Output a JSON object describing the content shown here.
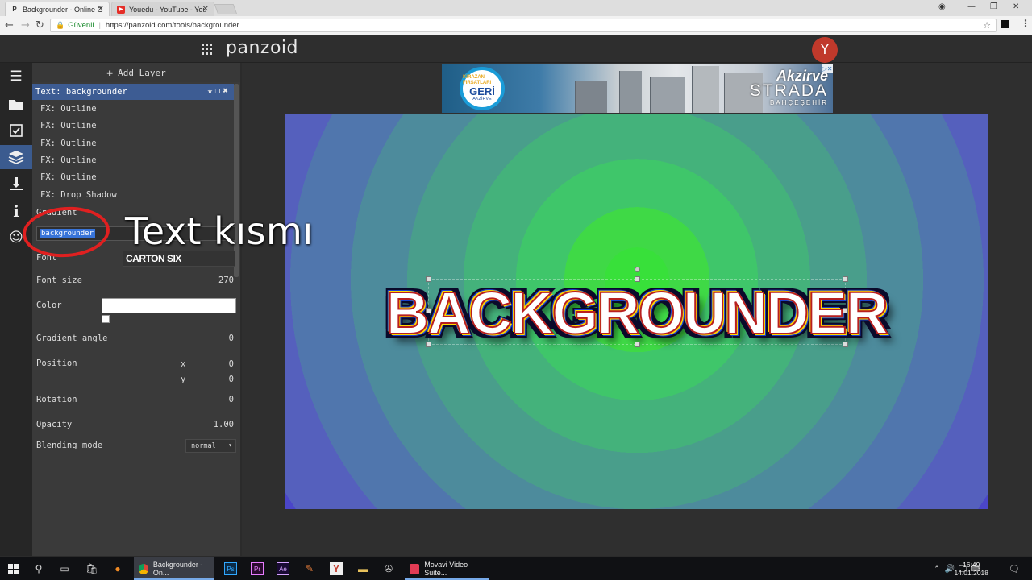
{
  "browser": {
    "tabs": [
      {
        "label": "Backgrounder - Online G",
        "active": true
      },
      {
        "label": "Youedu - YouTube - You",
        "active": false
      }
    ],
    "security_label": "Güvenli",
    "url": "https://panzoid.com/tools/backgrounder"
  },
  "app": {
    "brand": "panzoid",
    "avatar_letter": "Y"
  },
  "panel": {
    "add_layer_label": "Add Layer",
    "layer_title": "Text: backgrounder",
    "fx_items": [
      "FX: Outline",
      "FX: Outline",
      "FX: Outline",
      "FX: Outline",
      "FX: Outline",
      "FX: Drop Shadow"
    ],
    "gradient_label": "Gradient",
    "text_value": "backgrounder",
    "font_label": "Font",
    "font_value": "CARTON SIX",
    "font_size_label": "Font size",
    "font_size_value": "270",
    "color_label": "Color",
    "gradient_angle_label": "Gradient angle",
    "gradient_angle_value": "0",
    "position_label": "Position",
    "position_x_label": "x",
    "position_x_value": "0",
    "position_y_label": "y",
    "position_y_value": "0",
    "rotation_label": "Rotation",
    "rotation_value": "0",
    "opacity_label": "Opacity",
    "opacity_value": "1.00",
    "blending_label": "Blending mode",
    "blending_value": "normal"
  },
  "annotation": {
    "text": "Text kısmı"
  },
  "ad": {
    "badge_line1": "KIRAZAN FIRSATLARI",
    "badge_line2": "GERİ",
    "badge_line3": "AKZİRVE",
    "brand1": "Akzirve",
    "brand2": "STRADA",
    "brand3": "BAHÇEŞEHİR"
  },
  "canvas": {
    "text": "BACKGROUNDER"
  },
  "taskbar": {
    "active_app": "Backgrounder - On...",
    "movavi_app": "Movavi Video Suite...",
    "time": "16:49",
    "date": "14.01.2018"
  }
}
